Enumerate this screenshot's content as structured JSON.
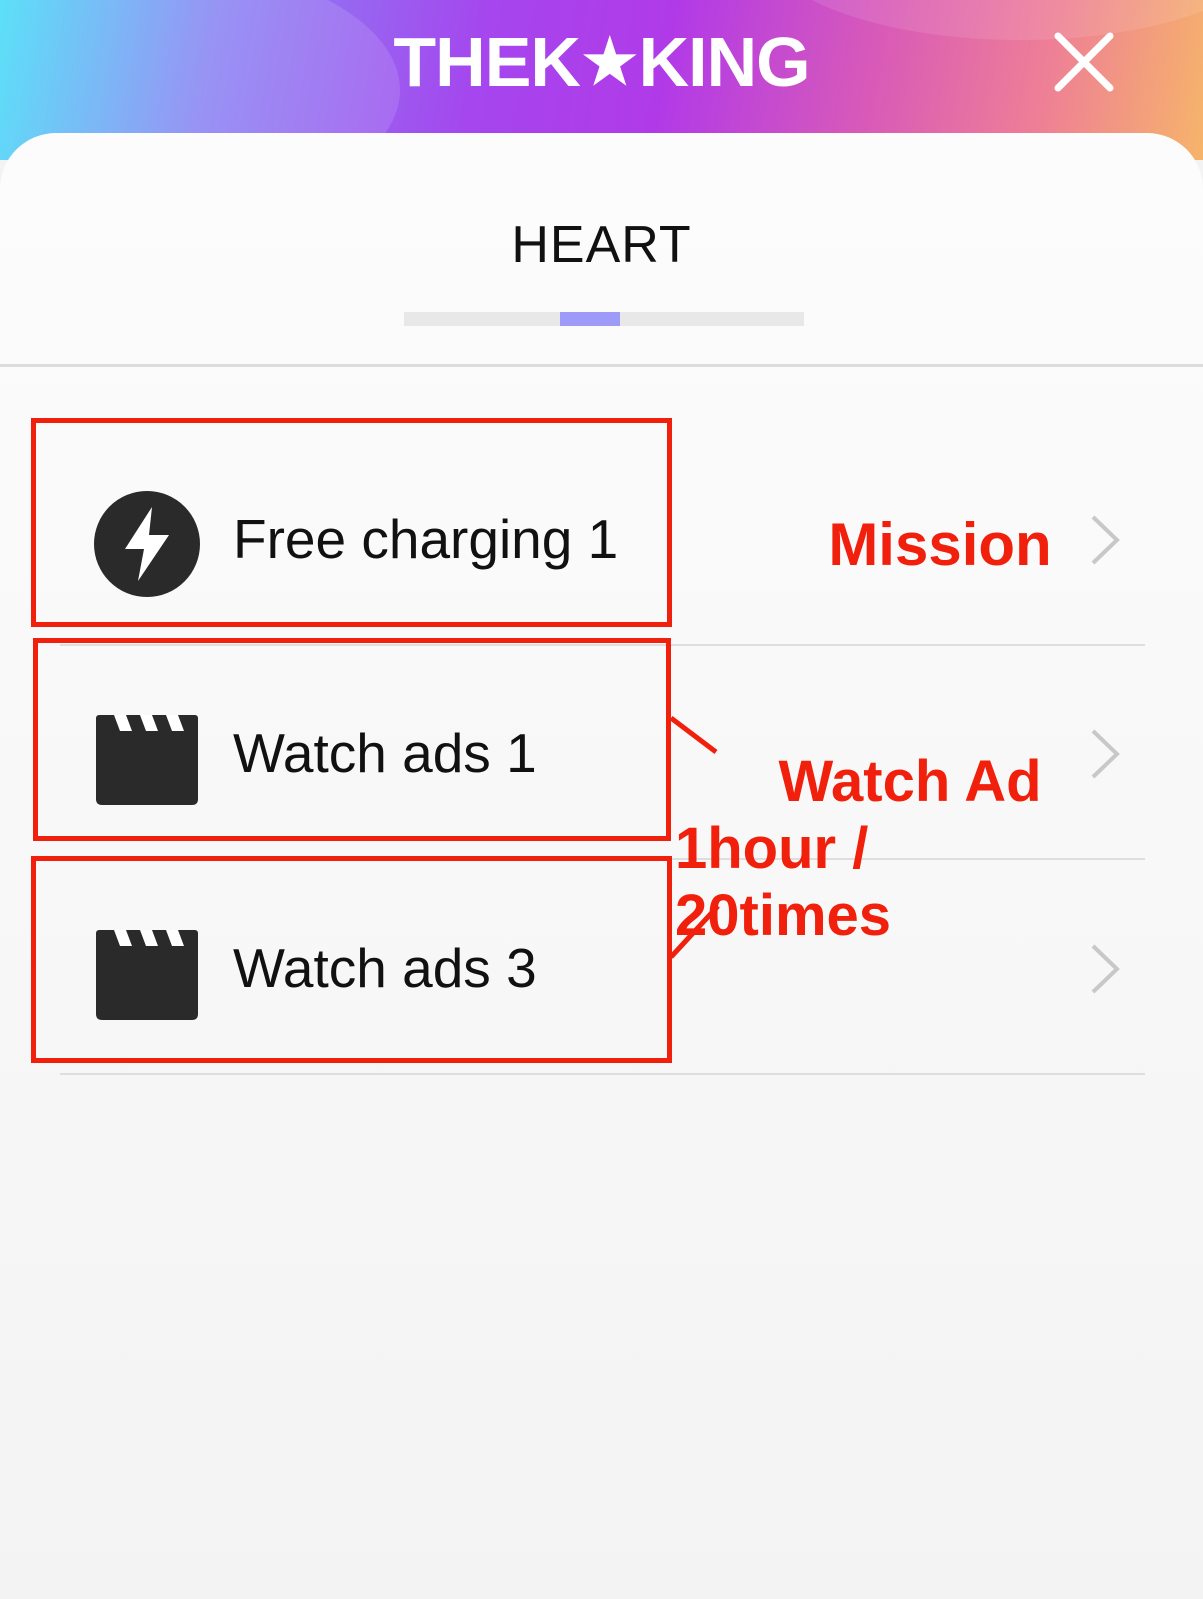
{
  "header": {
    "logo_left": "THEK",
    "logo_star": "★",
    "logo_right": "KING",
    "close_icon": "close-icon"
  },
  "title": "HEART",
  "tab_progress": {
    "position_fraction": 0.46,
    "segment_fraction": 0.15,
    "fill_color": "#9d9bf7"
  },
  "rows": [
    {
      "label": "Free charging 1",
      "icon": "lightning-icon",
      "chevron": "chevron-right-icon"
    },
    {
      "label": "Watch ads 1",
      "icon": "clapperboard-icon",
      "chevron": "chevron-right-icon"
    },
    {
      "label": "Watch ads 3",
      "icon": "clapperboard-icon",
      "chevron": "chevron-right-icon"
    }
  ],
  "annotations": {
    "mission": "Mission",
    "watch_ad_line1": "Watch Ad",
    "watch_ad_line2": "1hour / 20times",
    "color": "#f0200c"
  }
}
